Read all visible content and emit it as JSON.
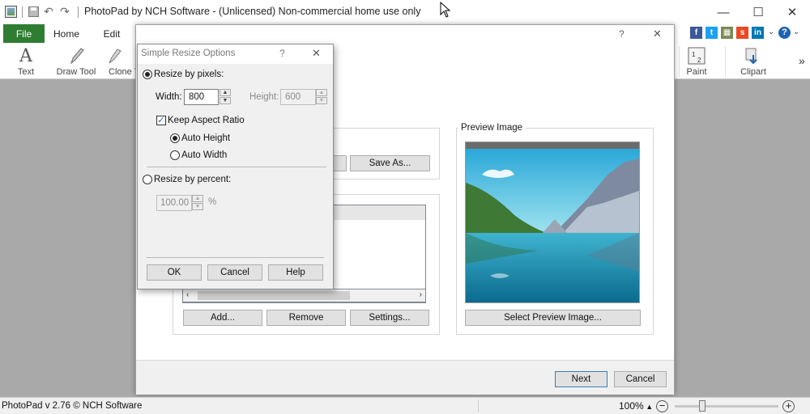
{
  "app": {
    "title": "PhotoPad by NCH Software - (Unlicensed) Non-commercial home use only",
    "tabs": [
      "File",
      "Home",
      "Edit"
    ],
    "ribbon": [
      "Text",
      "Draw Tool",
      "Clone T",
      "Paint",
      "Clipart"
    ],
    "status_text": "PhotoPad v 2.76 © NCH Software",
    "zoom": "100%",
    "zoom_level": 0.25
  },
  "wizard": {
    "save_as_label": "Save As...",
    "preview_title": "Preview Image",
    "add_label": "Add...",
    "remove_label": "Remove",
    "settings_label": "Settings...",
    "select_preview_label": "Select Preview Image...",
    "next_label": "Next",
    "cancel_label": "Cancel",
    "help_glyph": "?",
    "close_glyph": "✕"
  },
  "dialog": {
    "title": "Simple Resize Options",
    "help_glyph": "?",
    "close_glyph": "✕",
    "resize_by_pixels": "Resize by pixels:",
    "width_label": "Width:",
    "width_value": "800",
    "height_label": "Height:",
    "height_value": "600",
    "keep_aspect": "Keep Aspect Ratio",
    "auto_height": "Auto Height",
    "auto_width": "Auto Width",
    "resize_by_percent": "Resize by percent:",
    "percent_value": "100.00",
    "percent_unit": "%",
    "ok_label": "OK",
    "cancel_label": "Cancel",
    "help_label": "Help"
  },
  "colors": {
    "file_tab": "#2e7d32",
    "workspace": "#a9a9a9"
  }
}
